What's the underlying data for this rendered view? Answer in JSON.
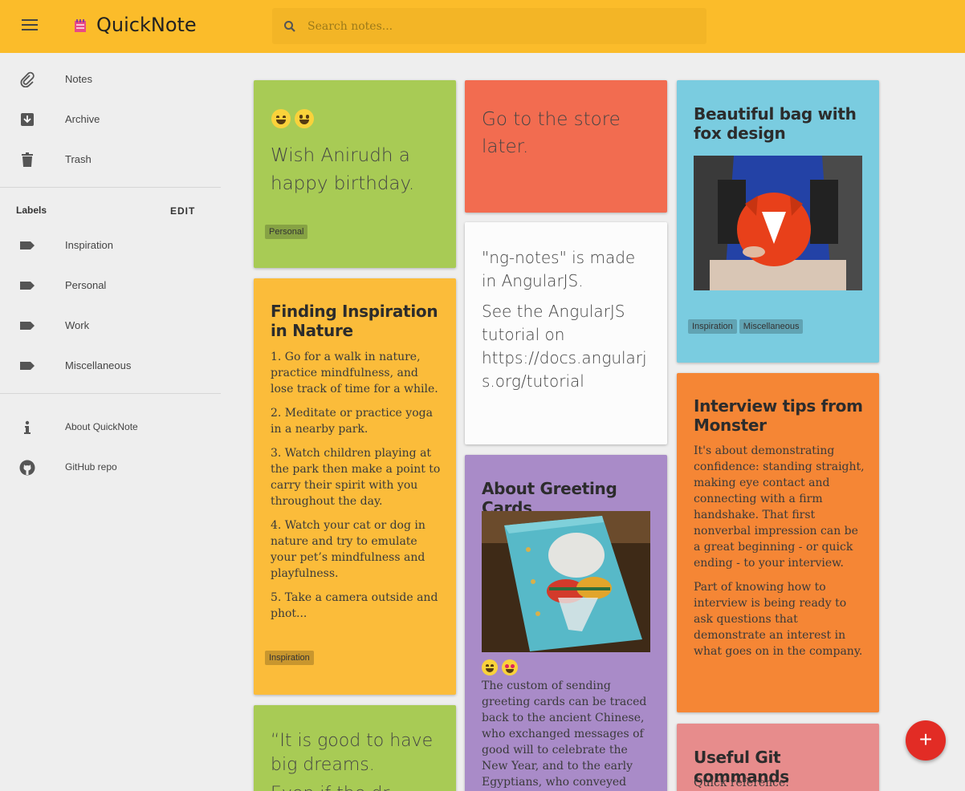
{
  "app": {
    "title": "QuickNote"
  },
  "search": {
    "placeholder": "Search notes..."
  },
  "sidebar": {
    "nav": [
      {
        "label": "Notes",
        "icon": "paperclip-icon"
      },
      {
        "label": "Archive",
        "icon": "archive-icon"
      },
      {
        "label": "Trash",
        "icon": "trash-icon"
      }
    ],
    "labels_heading": "Labels",
    "edit_label": "EDIT",
    "labels": [
      {
        "label": "Inspiration",
        "icon": "label-tag-icon"
      },
      {
        "label": "Personal",
        "icon": "label-tag-icon"
      },
      {
        "label": "Work",
        "icon": "label-tag-icon"
      },
      {
        "label": "Miscellaneous",
        "icon": "label-tag-icon"
      }
    ],
    "footer": [
      {
        "label": "About QuickNote",
        "icon": "info-icon"
      },
      {
        "label": "GitHub repo",
        "icon": "github-icon"
      }
    ]
  },
  "notes": {
    "birthday": {
      "color": "#a8cb55",
      "text": "Wish Anirudh a happy birthday.",
      "labels": [
        "Personal"
      ]
    },
    "inspiration": {
      "color": "#fbbc3a",
      "title": "Finding Inspiration in Nature",
      "items": [
        "1. Go for a walk in nature, practice mindfulness, and lose track of time for a while.",
        "2. Meditate or practice yoga in a nearby park.",
        "3. Watch children playing at the park then make a point to carry their spirit with you throughout the day.",
        "4. Watch your cat or dog in nature and try to emulate your pet’s mindfulness and playfulness.",
        "5. Take a camera outside and phot..."
      ],
      "labels": [
        "Inspiration"
      ]
    },
    "dreams": {
      "color": "#a8cb55",
      "line1": "“It is good to have big dreams.",
      "line2": "Even if the dr..."
    },
    "store": {
      "color": "#f26c50",
      "text": "Go to the store later."
    },
    "ngnotes": {
      "color": "#fcfcfc",
      "p1": "\"ng-notes\" is made in AngularJS.",
      "p2": "See the AngularJS tutorial on",
      "link": "https://docs.angularjs.org/tutorial"
    },
    "greeting": {
      "color": "#a98bc8",
      "title": "About Greeting Cards",
      "text": "The custom of sending greeting cards can be traced back to the ancient Chinese, who exchanged messages of good will to celebrate the New Year, and to the early Egyptians, who conveyed their"
    },
    "bag": {
      "color": "#7acce0",
      "title": "Beautiful bag with fox design",
      "labels": [
        "Inspiration",
        "Miscellaneous"
      ]
    },
    "interview": {
      "color": "#f58635",
      "title": "Interview tips from Monster",
      "p1": "It's about demonstrating confidence: standing straight, making eye contact and connecting with a firm handshake. That first nonverbal impression can be a great beginning - or quick ending - to your interview.",
      "p2": "Part of knowing how to interview is being ready to ask questions that demonstrate an interest in what goes on in the company."
    },
    "git": {
      "color": "#e78c8c",
      "title": "Useful Git commands",
      "text": "Quick reference:"
    }
  },
  "fab": {
    "label": "+",
    "color": "#e22c25"
  }
}
